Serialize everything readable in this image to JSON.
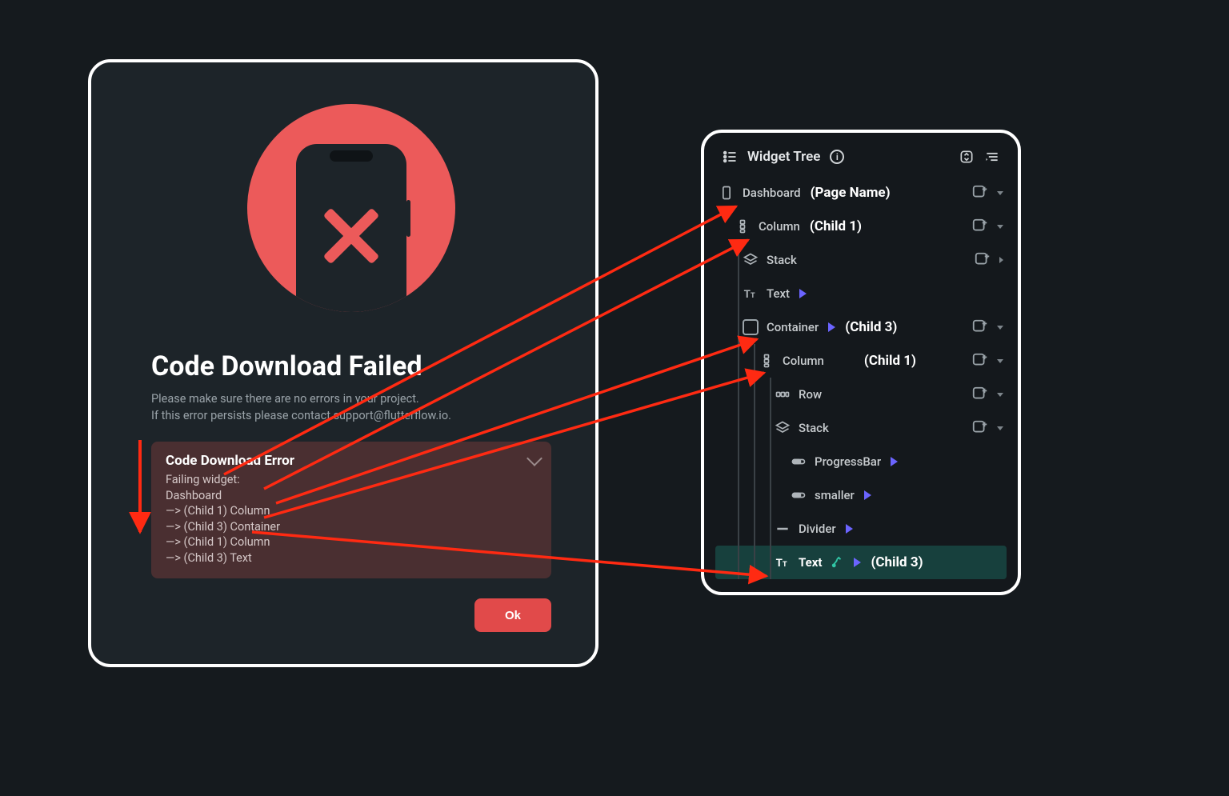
{
  "dialog": {
    "title": "Code Download Failed",
    "subtitle": "Please make sure there are no errors in your project.\nIf this error persists please contact support@flutterflow.io.",
    "err_header": "Code Download Error",
    "lines": {
      "failing": "Failing widget:",
      "l0": "Dashboard",
      "l1": "—> (Child 1) Column",
      "l2": "—> (Child 3) Container",
      "l3": "—> (Child 1) Column",
      "l4": "—> (Child 3) Text"
    },
    "ok": "Ok"
  },
  "tree": {
    "title": "Widget Tree",
    "nodes": {
      "dashboard": "Dashboard",
      "column1": "Column",
      "stack1": "Stack",
      "text1": "Text",
      "container": "Container",
      "column2": "Column",
      "row": "Row",
      "stack2": "Stack",
      "progress": "ProgressBar",
      "smaller": "smaller",
      "divider": "Divider",
      "text2": "Text"
    },
    "annotations": {
      "page": "(Page Name)",
      "c1a": "(Child 1)",
      "c3a": "(Child 3)",
      "c1b": "(Child 1)",
      "c3b": "(Child 3)"
    }
  }
}
